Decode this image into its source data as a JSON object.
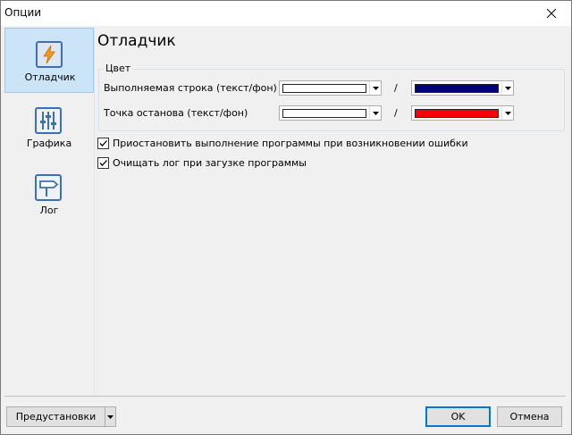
{
  "window": {
    "title": "Опции",
    "close_icon": "close-icon"
  },
  "sidebar": {
    "items": [
      {
        "label": "Отладчик",
        "icon": "lightning-icon",
        "selected": true
      },
      {
        "label": "Графика",
        "icon": "sliders-icon",
        "selected": false
      },
      {
        "label": "Лог",
        "icon": "signpost-icon",
        "selected": false
      }
    ]
  },
  "main": {
    "title": "Отладчик",
    "color_group": {
      "label": "Цвет",
      "rows": [
        {
          "label": "Выполняемая строка (текст/фон)",
          "separator": "/",
          "text_color": "#ffffff",
          "bg_color": "#00007f"
        },
        {
          "label": "Точка останова (текст/фон)",
          "separator": "/",
          "text_color": "#ffffff",
          "bg_color": "#ff0000"
        }
      ]
    },
    "checkboxes": [
      {
        "label": "Приостановить выполнение программы при возникновении ошибки",
        "checked": true
      },
      {
        "label": "Очищать лог при загузке программы",
        "checked": true
      }
    ]
  },
  "footer": {
    "presets_label": "Предустановки",
    "ok_label": "OK",
    "cancel_label": "Отмена"
  }
}
